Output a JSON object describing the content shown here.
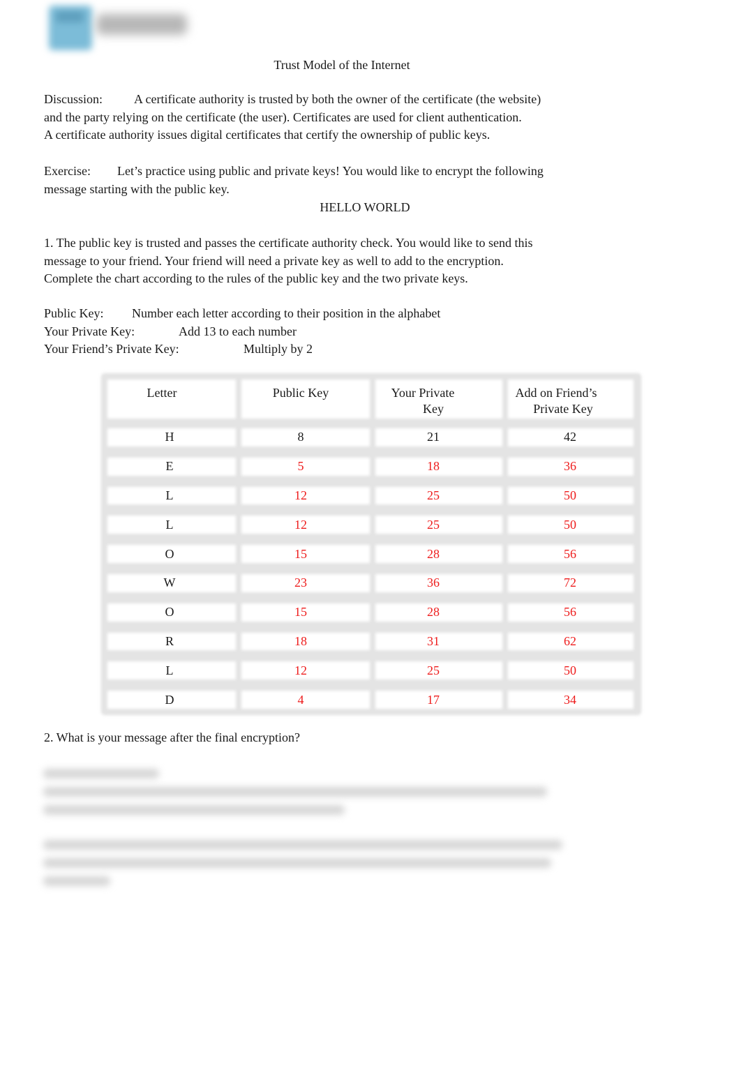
{
  "header": {
    "logo_icon": "logo-mark",
    "title": "Trust Model of the Internet"
  },
  "discussion": {
    "label": "Discussion:",
    "line1": "A certificate authority is trusted by both the owner of the certificate (the website)",
    "line2": "and the party relying on the certificate (the user). Certificates are used for client authentication.",
    "line3": "A certificate authority issues digital certificates that certify the ownership of public keys."
  },
  "exercise": {
    "label": "Exercise:",
    "line1": "Let’s practice using public and private keys! You would like to encrypt the following",
    "line2": "message starting with the public key.",
    "message": "HELLO WORLD"
  },
  "question1": {
    "line1": "1. The public key is trusted and passes the certificate authority check. You would like to send this",
    "line2": "message to your friend. Your friend will need a private key as well to add to the encryption.",
    "line3": "Complete the chart according to the rules of the public key and the two private keys."
  },
  "rules": [
    {
      "label": "Public Key:",
      "rule": "Number each letter according to their position in the alphabet"
    },
    {
      "label": "Your Private Key:",
      "rule": "Add 13 to each number"
    },
    {
      "label": "Your Friend’s Private Key:",
      "rule": "Multiply by 2"
    }
  ],
  "table": {
    "headers": [
      {
        "line1": "Letter",
        "line2": ""
      },
      {
        "line1": "Public Key",
        "line2": ""
      },
      {
        "line1": "Your Private",
        "line2": "Key"
      },
      {
        "line1": "Add on Friend’s",
        "line2": "Private Key"
      }
    ],
    "answer_color": "#ee1c1c",
    "rows": [
      {
        "letter": "H",
        "public": "8",
        "private": "21",
        "friend": "42",
        "answered": false
      },
      {
        "letter": "E",
        "public": "5",
        "private": "18",
        "friend": "36",
        "answered": true
      },
      {
        "letter": "L",
        "public": "12",
        "private": "25",
        "friend": "50",
        "answered": true
      },
      {
        "letter": "L",
        "public": "12",
        "private": "25",
        "friend": "50",
        "answered": true
      },
      {
        "letter": "O",
        "public": "15",
        "private": "28",
        "friend": "56",
        "answered": true
      },
      {
        "letter": "W",
        "public": "23",
        "private": "36",
        "friend": "72",
        "answered": true
      },
      {
        "letter": "O",
        "public": "15",
        "private": "28",
        "friend": "56",
        "answered": true
      },
      {
        "letter": "R",
        "public": "18",
        "private": "31",
        "friend": "62",
        "answered": true
      },
      {
        "letter": "L",
        "public": "12",
        "private": "25",
        "friend": "50",
        "answered": true
      },
      {
        "letter": "D",
        "public": "4",
        "private": "17",
        "friend": "34",
        "answered": true
      }
    ]
  },
  "question2": {
    "text": "2. What is your message after the final encryption?"
  }
}
